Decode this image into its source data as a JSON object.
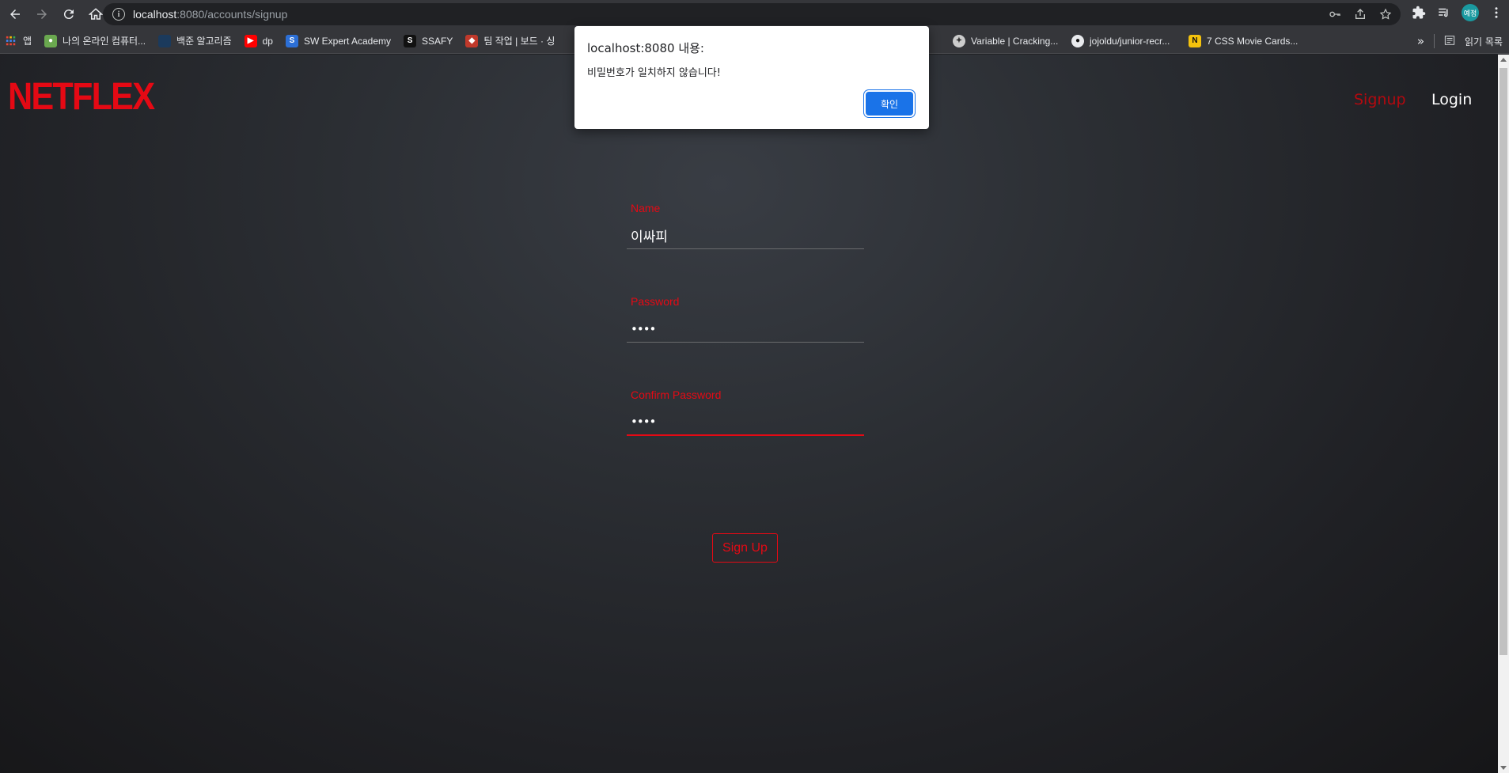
{
  "browser": {
    "url_host": "localhost",
    "url_path": ":8080/accounts/signup",
    "bookmarks": [
      {
        "label": "앱",
        "color": "#4285f4"
      },
      {
        "label": "나의 온라인 컴퓨터...",
        "color": "#6aa84f"
      },
      {
        "label": "백준 알고리즘",
        "color": "#1b3a5c"
      },
      {
        "label": "dp",
        "color": "#ff0000"
      },
      {
        "label": "SW Expert Academy",
        "color": "#2c6fd6"
      },
      {
        "label": "SSAFY",
        "color": "#111111"
      },
      {
        "label": "팀 작업 | 보드 · 싱",
        "color": "#c0392b"
      },
      {
        "label": "Variable | Cracking...",
        "color": "#cccccc"
      },
      {
        "label": "jojoldu/junior-recr...",
        "color": "#e8eaed"
      },
      {
        "label": "7 CSS Movie Cards...",
        "color": "#f4c20d"
      }
    ],
    "overflow_label": "»",
    "reading_list_label": "읽기 목록",
    "profile_label": "예정"
  },
  "page": {
    "logo": "NETFLEX",
    "nav": {
      "signup": "Signup",
      "login": "Login"
    },
    "form": {
      "name_label": "Name",
      "name_value": "이싸피",
      "password_label": "Password",
      "password_value": "••••",
      "confirm_label": "Confirm Password",
      "confirm_value": "••••",
      "submit_label": "Sign Up"
    }
  },
  "dialog": {
    "title": "localhost:8080 내용:",
    "message": "비밀번호가 일치하지 않습니다!",
    "ok_label": "확인"
  },
  "colors": {
    "accent": "#e50914",
    "dialog_button": "#1a73e8"
  }
}
